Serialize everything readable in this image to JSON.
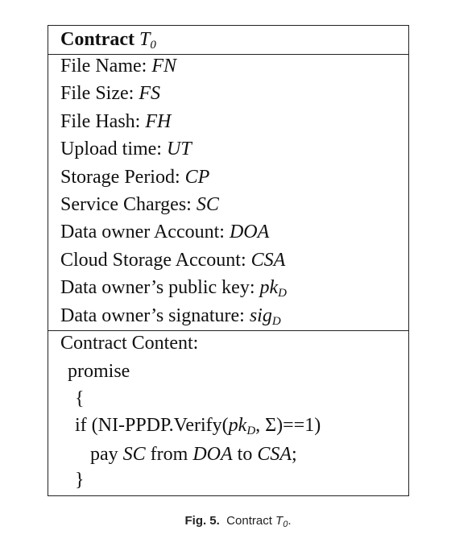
{
  "contract": {
    "title_label": "Contract",
    "title_symbol": "T",
    "title_sub": "0",
    "fields": [
      {
        "label": "File Name: ",
        "symbol": "FN",
        "sub": ""
      },
      {
        "label": "File Size: ",
        "symbol": "FS",
        "sub": ""
      },
      {
        "label": "File Hash: ",
        "symbol": "FH",
        "sub": ""
      },
      {
        "label": "Upload time: ",
        "symbol": "UT",
        "sub": ""
      },
      {
        "label": "Storage Period: ",
        "symbol": "CP",
        "sub": ""
      },
      {
        "label": "Service Charges: ",
        "symbol": "SC",
        "sub": ""
      },
      {
        "label": "Data owner Account: ",
        "symbol": "DOA",
        "sub": ""
      },
      {
        "label": "Cloud Storage Account: ",
        "symbol": "CSA",
        "sub": ""
      },
      {
        "label": "Data owner’s public key: ",
        "symbol": "pk",
        "sub": "D"
      },
      {
        "label": "Data owner’s signature: ",
        "symbol": "sig",
        "sub": "D"
      }
    ],
    "content": {
      "heading": "Contract Content:",
      "promise": "promise",
      "open_brace": "{",
      "if_prefix": "if (NI-PPDP.Verify(",
      "if_sym": "pk",
      "if_sub": "D",
      "if_suffix": ", Σ)==1)",
      "pay_word": "pay ",
      "pay_sc": "SC",
      "from_word": " from ",
      "pay_doa": "DOA",
      "to_word": " to ",
      "pay_csa": "CSA",
      "semicolon": ";",
      "close_brace": "}"
    }
  },
  "caption": {
    "fig_label": "Fig. 5.",
    "text": "Contract ",
    "symbol": "T",
    "sub": "0",
    "end": "."
  }
}
